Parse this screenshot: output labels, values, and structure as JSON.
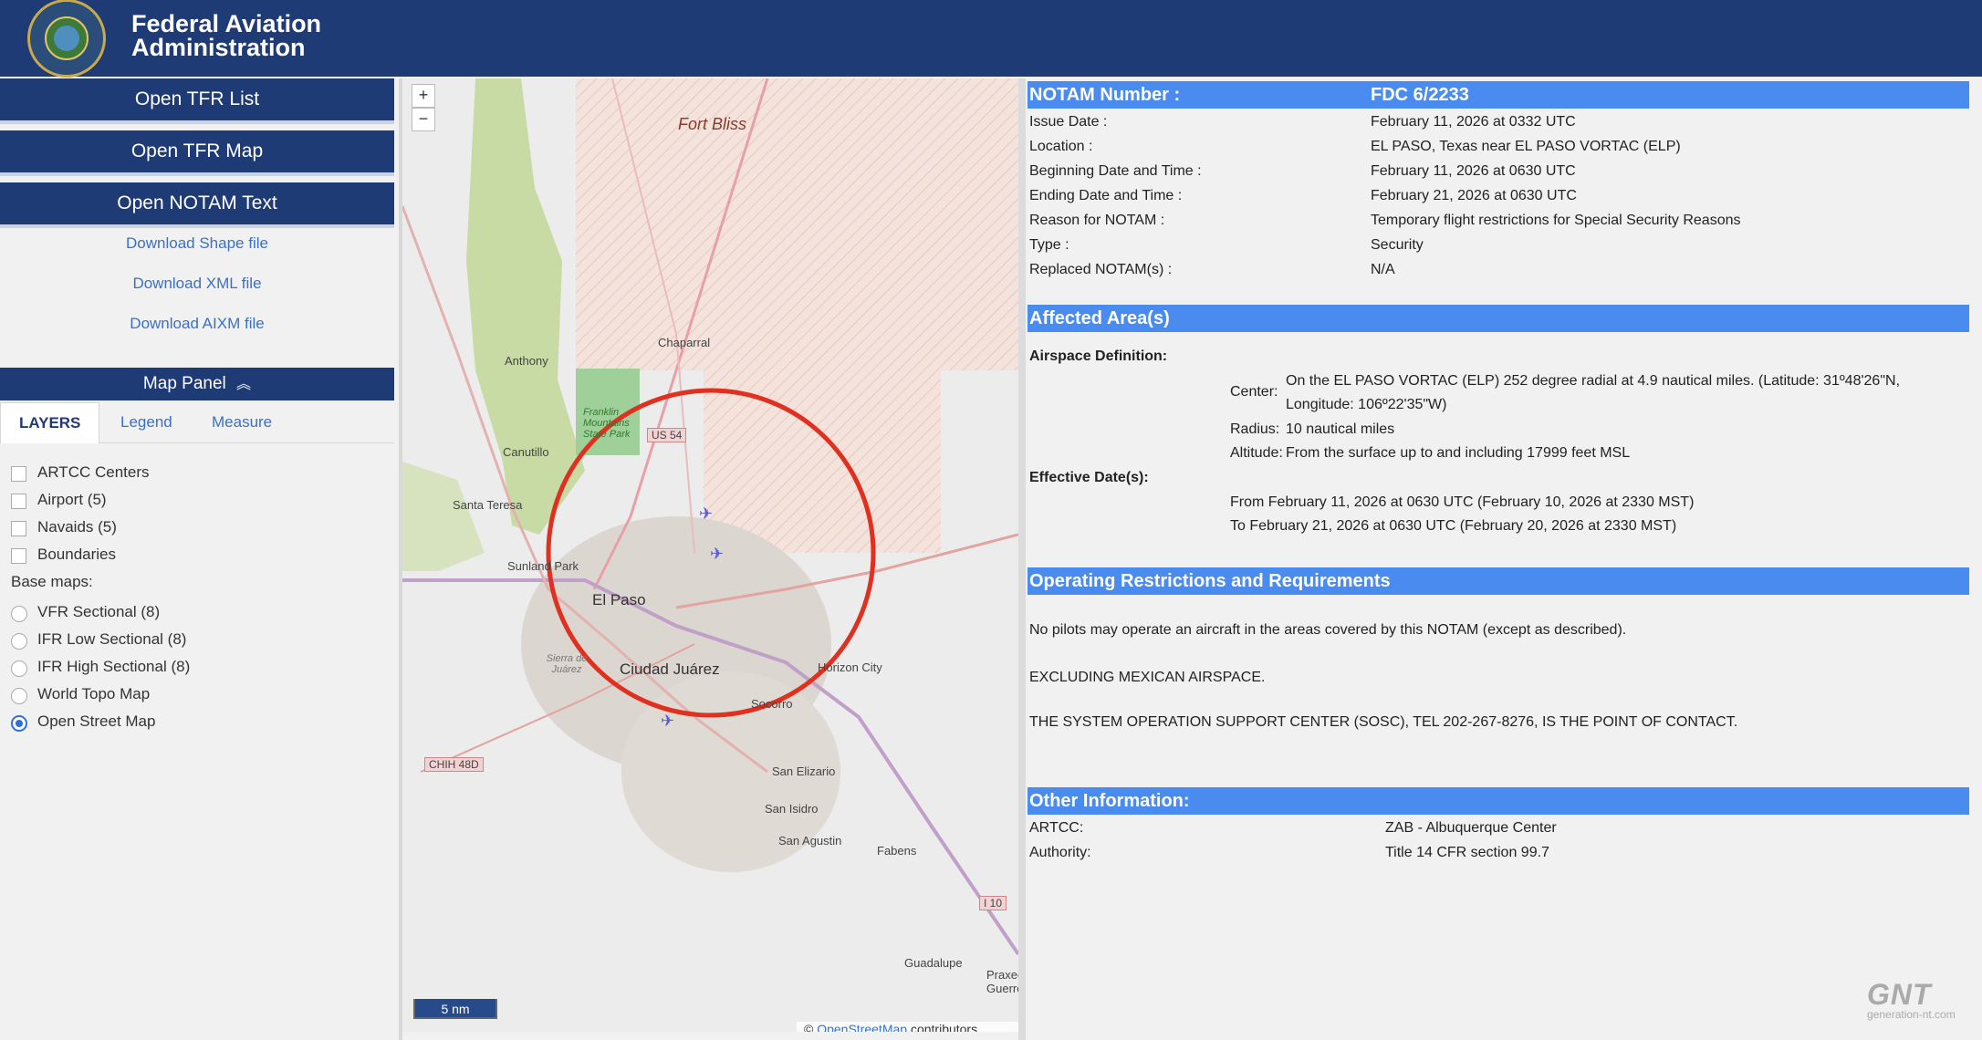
{
  "header": {
    "title_line1": "Federal Aviation",
    "title_line2": "Administration",
    "seal_text": "FEDERAL AVIATION ADMINISTRATION"
  },
  "left": {
    "buttons": [
      "Open TFR List",
      "Open TFR Map",
      "Open NOTAM Text"
    ],
    "downloads": [
      "Download Shape file",
      "Download XML file",
      "Download AIXM file"
    ],
    "map_panel_label": "Map Panel",
    "tabs": [
      "LAYERS",
      "Legend",
      "Measure"
    ],
    "layers": [
      {
        "label": "ARTCC Centers",
        "checked": false
      },
      {
        "label": "Airport (5)",
        "checked": false
      },
      {
        "label": "Navaids (5)",
        "checked": false
      },
      {
        "label": "Boundaries",
        "checked": false
      }
    ],
    "base_maps_label": "Base maps:",
    "base_maps": [
      {
        "label": "VFR Sectional (8)",
        "selected": false
      },
      {
        "label": "IFR Low Sectional (8)",
        "selected": false
      },
      {
        "label": "IFR High Sectional (8)",
        "selected": false
      },
      {
        "label": "World Topo Map",
        "selected": false
      },
      {
        "label": "Open Street Map",
        "selected": true
      }
    ]
  },
  "map": {
    "zoom_in": "+",
    "zoom_out": "−",
    "scale_label": "5 nm",
    "attribution_prefix": "©",
    "attribution_link": "OpenStreetMap",
    "attribution_suffix": "contributors",
    "places": [
      "Fort Bliss",
      "Chaparral",
      "Anthony",
      "Canutillo",
      "Franklin Mountains State Park",
      "Santa Teresa",
      "Sunland Park",
      "El Paso",
      "Ciudad Juárez",
      "Sierra de Juárez",
      "Horizon City",
      "Socorro",
      "San Elizario",
      "San Isidro",
      "San Agustin",
      "Fabens",
      "Guadalupe",
      "Praxedis Guerrero"
    ],
    "roads": [
      "US 54",
      "CHIH 48D",
      "I 10"
    ],
    "tfr_color": "#e03020"
  },
  "notam": {
    "number_label": "NOTAM Number :",
    "number_value": "FDC 6/2233",
    "fields": [
      {
        "label": "Issue Date :",
        "value": "February 11, 2026 at 0332 UTC"
      },
      {
        "label": "Location :",
        "value": "EL PASO, Texas near EL PASO VORTAC (ELP)"
      },
      {
        "label": "Beginning Date and Time :",
        "value": "February 11, 2026 at 0630 UTC"
      },
      {
        "label": "Ending Date and Time :",
        "value": "February 21, 2026 at 0630 UTC"
      },
      {
        "label": "Reason for NOTAM :",
        "value": "Temporary flight restrictions for Special Security Reasons"
      },
      {
        "label": "Type :",
        "value": "Security"
      },
      {
        "label": "Replaced NOTAM(s) :",
        "value": "N/A"
      }
    ],
    "affected_title": "Affected Area(s)",
    "airspace_definition_label": "Airspace Definition:",
    "center_label": "Center:",
    "center_value_line1": "On the EL PASO VORTAC (ELP) 252 degree radial at 4.9 nautical miles. (Latitude: 31º48'26\"N,",
    "center_value_line2": "Longitude: 106º22'35\"W)",
    "radius_label": "Radius:",
    "radius_value": "10 nautical miles",
    "altitude_label": "Altitude:",
    "altitude_value": "From the surface up to and including 17999 feet MSL",
    "effective_label": "Effective Date(s):",
    "effective_from": "From February 11, 2026 at 0630 UTC (February 10, 2026 at 2330 MST)",
    "effective_to": "To February 21, 2026 at 0630 UTC (February 20, 2026 at 2330 MST)",
    "operating_title": "Operating Restrictions and Requirements",
    "operating_lines": [
      "No pilots may operate an aircraft in the areas covered by this NOTAM (except as described).",
      "EXCLUDING MEXICAN AIRSPACE.",
      "THE SYSTEM OPERATION SUPPORT CENTER (SOSC), TEL 202-267-8276, IS THE POINT OF CONTACT."
    ],
    "other_title": "Other Information:",
    "other_fields": [
      {
        "label": "ARTCC:",
        "value": "ZAB - Albuquerque Center"
      },
      {
        "label": "Authority:",
        "value": "Title 14 CFR section 99.7"
      }
    ]
  },
  "watermark": {
    "big": "GNT",
    "small": "generation-nt.com"
  }
}
